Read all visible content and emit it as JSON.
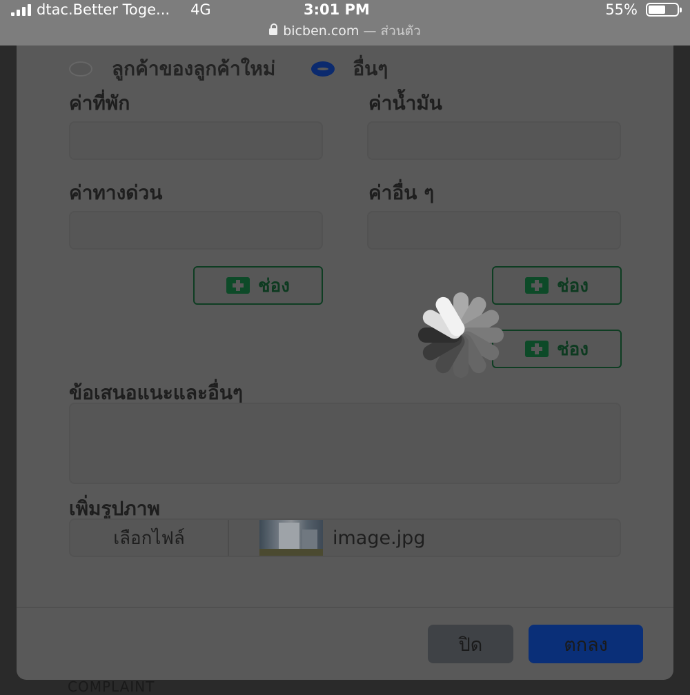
{
  "status_bar": {
    "carrier": "dtac.Better Toge...",
    "network": "4G",
    "time": "3:01 PM",
    "battery_percent": "55%",
    "battery_level": 0.55
  },
  "url_bar": {
    "domain": "bicben.com",
    "mode": "— ส่วนตัว"
  },
  "form": {
    "radio_options": [
      {
        "label": "ลูกค้าของลูกค้าใหม่",
        "selected": false
      },
      {
        "label": "อื่นๆ",
        "selected": true
      }
    ],
    "fields": {
      "accommodation_label": "ค่าที่พัก",
      "fuel_label": "ค่าน้ำมัน",
      "toll_label": "ค่าทางด่วน",
      "other_cost_label": "ค่าอื่น ๆ"
    },
    "add_slot_label": "ช่อง",
    "suggestion_label": "ข้อเสนอแนะและอื่นๆ",
    "image_label": "เพิ่มรูปภาพ",
    "choose_file_label": "เลือกไฟล์",
    "file_name": "image.jpg"
  },
  "footer": {
    "close_label": "ปิด",
    "ok_label": "ตกลง"
  },
  "background_text": "COMPLAINT",
  "colors": {
    "ok_button": "#0a2f78",
    "close_button": "#3f4246",
    "add_button_accent": "#0d4a28",
    "overlay": "#595959"
  },
  "loading_spinner": {
    "visible": true,
    "icon": "spinner-icon"
  }
}
